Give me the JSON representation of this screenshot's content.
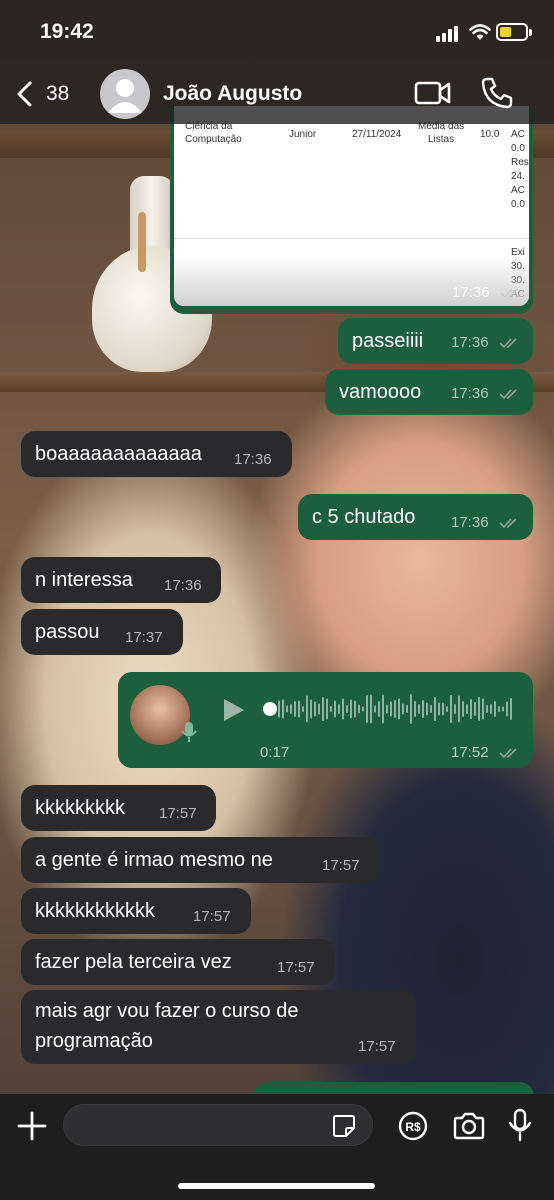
{
  "status_bar": {
    "time": "19:42"
  },
  "header": {
    "back_count": "38",
    "contact_name": "João Augusto"
  },
  "document_preview": {
    "cells": [
      "Ciência da\nComputação",
      "Junior",
      "27/11/2024",
      "Média das\nListas",
      "10.0",
      "AC\n0.0\nRes\n24.\nAC\n0.0",
      "Exi\n30.\n30.\nAC"
    ],
    "time": "17:36"
  },
  "messages": [
    {
      "direction": "out",
      "text": "passeiiii",
      "time": "17:36"
    },
    {
      "direction": "out",
      "text": "vamoooo",
      "time": "17:36"
    },
    {
      "direction": "in",
      "text": "boaaaaaaaaaaaaa",
      "time": "17:36"
    },
    {
      "direction": "out",
      "text": "c 5 chutado",
      "time": "17:36"
    },
    {
      "direction": "in",
      "text": "n interessa",
      "time": "17:36"
    },
    {
      "direction": "in",
      "text": "passou",
      "time": "17:37"
    },
    {
      "direction": "in",
      "text": "kkkkkkkkk",
      "time": "17:57"
    },
    {
      "direction": "in",
      "text": "a gente é irmao mesmo ne",
      "time": "17:57"
    },
    {
      "direction": "in",
      "text": "kkkkkkkkkkkk",
      "time": "17:57"
    },
    {
      "direction": "in",
      "text": "fazer pela terceira vez",
      "time": "17:57"
    },
    {
      "direction": "in",
      "text_line1": "mais agr vou fazer o curso de",
      "text_line2": "programação",
      "time": "17:57"
    }
  ],
  "voice_message": {
    "duration": "0:17",
    "time": "17:52",
    "progress": 0
  },
  "colors": {
    "outgoing_bubble": "#1c5f3d",
    "incoming_bubble": "#2a2a2c",
    "battery": "#f2d221"
  },
  "icons": {
    "back": "chevron-left-icon",
    "video": "video-camera-icon",
    "call": "phone-icon",
    "plus": "plus-icon",
    "sticker": "sticker-icon",
    "payment": "pix-payment-icon",
    "camera": "camera-icon",
    "mic": "microphone-icon"
  }
}
